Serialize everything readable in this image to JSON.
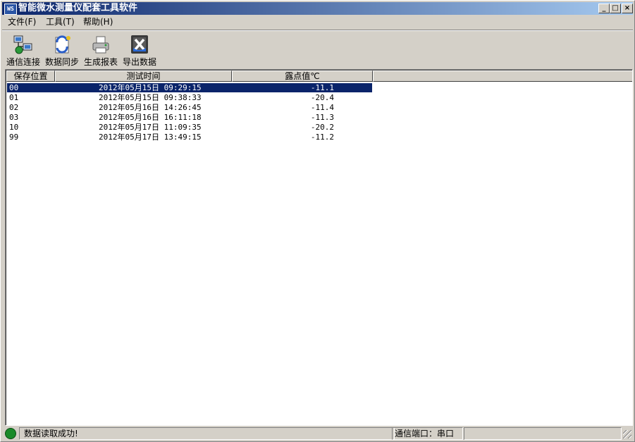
{
  "window": {
    "title": "智能微水测量仪配套工具软件",
    "app_icon_text": "WS",
    "min_label": "_",
    "max_label": "□",
    "close_label": "×"
  },
  "menu": [
    {
      "label": "文件(F)"
    },
    {
      "label": "工具(T)"
    },
    {
      "label": "帮助(H)"
    }
  ],
  "toolbar": [
    {
      "label": "通信连接",
      "icon": "network-connect-icon"
    },
    {
      "label": "数据同步",
      "icon": "data-sync-icon"
    },
    {
      "label": "生成报表",
      "icon": "printer-report-icon"
    },
    {
      "label": "导出数据",
      "icon": "excel-export-icon"
    }
  ],
  "table": {
    "columns": [
      "保存位置",
      "测试时间",
      "露点值℃"
    ],
    "rows": [
      {
        "pos": "00",
        "time": "2012年05月15日 09:29:15",
        "dew": "-11.1",
        "selected": true
      },
      {
        "pos": "01",
        "time": "2012年05月15日 09:38:33",
        "dew": "-20.4"
      },
      {
        "pos": "02",
        "time": "2012年05月16日 14:26:45",
        "dew": "-11.4"
      },
      {
        "pos": "03",
        "time": "2012年05月16日 16:11:18",
        "dew": "-11.3"
      },
      {
        "pos": "10",
        "time": "2012年05月17日 11:09:35",
        "dew": "-20.2"
      },
      {
        "pos": "99",
        "time": "2012年05月17日 13:49:15",
        "dew": "-11.2"
      }
    ]
  },
  "status": {
    "message": "数据读取成功!",
    "port": "通信端口：串口",
    "indicator_color": "#1a8a2a"
  },
  "colors": {
    "title_start": "#0a246a",
    "title_end": "#a6caf0",
    "selection": "#0a246a"
  }
}
